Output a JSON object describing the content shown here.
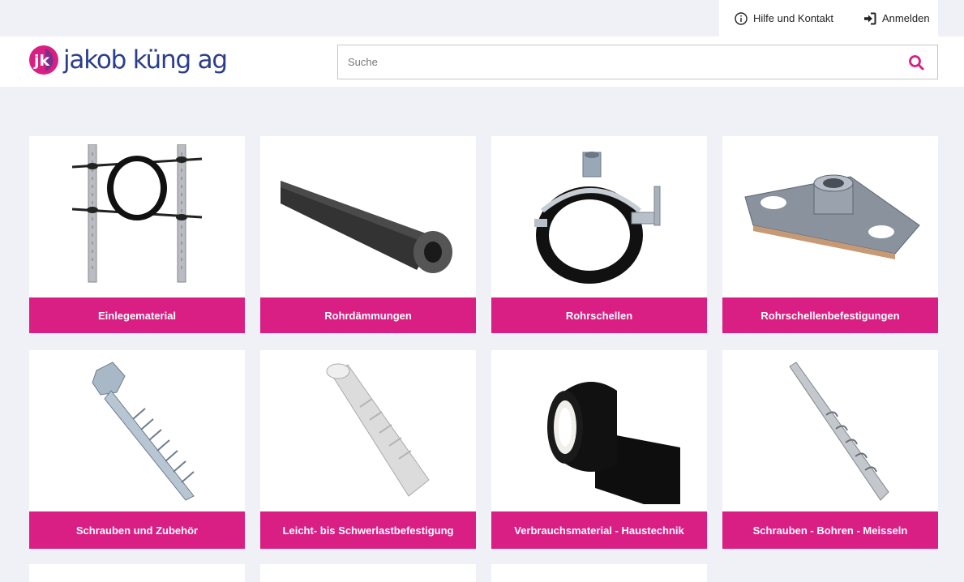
{
  "topbar": {
    "help_label": "Hilfe und Kontakt",
    "login_label": "Anmelden"
  },
  "brand": {
    "name": "jakob küng ag",
    "mark": "jk",
    "colors": {
      "primary": "#2b3e8c",
      "accent": "#d91f84"
    }
  },
  "search": {
    "placeholder": "Suche",
    "value": ""
  },
  "categories": [
    {
      "label": "Einlegematerial",
      "icon": "pipe-support-bracket"
    },
    {
      "label": "Rohrdämmungen",
      "icon": "foam-pipe-insulation"
    },
    {
      "label": "Rohrschellen",
      "icon": "pipe-clamp"
    },
    {
      "label": "Rohrschellenbefestigungen",
      "icon": "mounting-plate"
    },
    {
      "label": "Schrauben und Zubehör",
      "icon": "hex-screw"
    },
    {
      "label": "Leicht- bis Schwerlastbefestigung",
      "icon": "wall-plug"
    },
    {
      "label": "Verbrauchsmaterial - Haustechnik",
      "icon": "tape-roll"
    },
    {
      "label": "Schrauben - Bohren - Meisseln",
      "icon": "drill-bit"
    },
    {
      "label": "",
      "icon": "partial"
    },
    {
      "label": "",
      "icon": "partial"
    },
    {
      "label": "",
      "icon": "partial"
    }
  ]
}
